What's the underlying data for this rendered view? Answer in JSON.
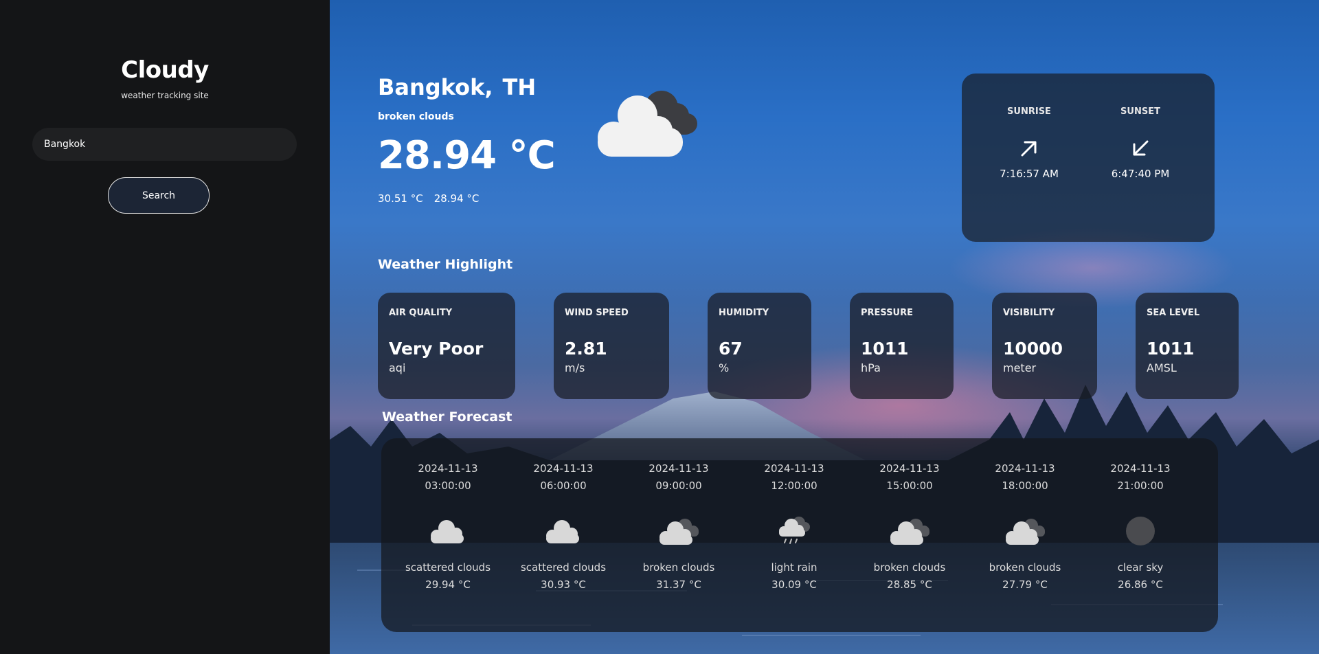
{
  "sidebar": {
    "brand": "Cloudy",
    "tagline": "weather tracking site",
    "search_value": "Bangkok",
    "search_button": "Search"
  },
  "current": {
    "city": "Bangkok,",
    "country": "TH",
    "description": "broken clouds",
    "temperature": "28.94 °C",
    "temp_max": "30.51 °C",
    "temp_min": "28.94 °C",
    "icon": "broken-clouds-icon"
  },
  "sun": {
    "sunrise_label": "SUNRISE",
    "sunrise_time": "7:16:57 AM",
    "sunset_label": "SUNSET",
    "sunset_time": "6:47:40 PM"
  },
  "highlight": {
    "title": "Weather Highlight",
    "cards": [
      {
        "label": "AIR QUALITY",
        "value": "Very Poor",
        "unit": "aqi"
      },
      {
        "label": "WIND SPEED",
        "value": "2.81",
        "unit": "m/s"
      },
      {
        "label": "HUMIDITY",
        "value": "67",
        "unit": "%"
      },
      {
        "label": "PRESSURE",
        "value": "1011",
        "unit": "hPa"
      },
      {
        "label": "VISIBILITY",
        "value": "10000",
        "unit": "meter"
      },
      {
        "label": "SEA LEVEL",
        "value": "1011",
        "unit": "AMSL"
      }
    ]
  },
  "forecast": {
    "title": "Weather Forecast",
    "items": [
      {
        "date": "2024-11-13",
        "time": "03:00:00",
        "desc": "scattered clouds",
        "temp": "29.94 °C",
        "icon": "scattered-clouds-icon"
      },
      {
        "date": "2024-11-13",
        "time": "06:00:00",
        "desc": "scattered clouds",
        "temp": "30.93 °C",
        "icon": "scattered-clouds-icon"
      },
      {
        "date": "2024-11-13",
        "time": "09:00:00",
        "desc": "broken clouds",
        "temp": "31.37 °C",
        "icon": "broken-clouds-icon"
      },
      {
        "date": "2024-11-13",
        "time": "12:00:00",
        "desc": "light rain",
        "temp": "30.09 °C",
        "icon": "light-rain-icon"
      },
      {
        "date": "2024-11-13",
        "time": "15:00:00",
        "desc": "broken clouds",
        "temp": "28.85 °C",
        "icon": "broken-clouds-icon"
      },
      {
        "date": "2024-11-13",
        "time": "18:00:00",
        "desc": "broken clouds",
        "temp": "27.79 °C",
        "icon": "broken-clouds-icon"
      },
      {
        "date": "2024-11-13",
        "time": "21:00:00",
        "desc": "clear sky",
        "temp": "26.86 °C",
        "icon": "clear-sky-icon"
      }
    ]
  }
}
